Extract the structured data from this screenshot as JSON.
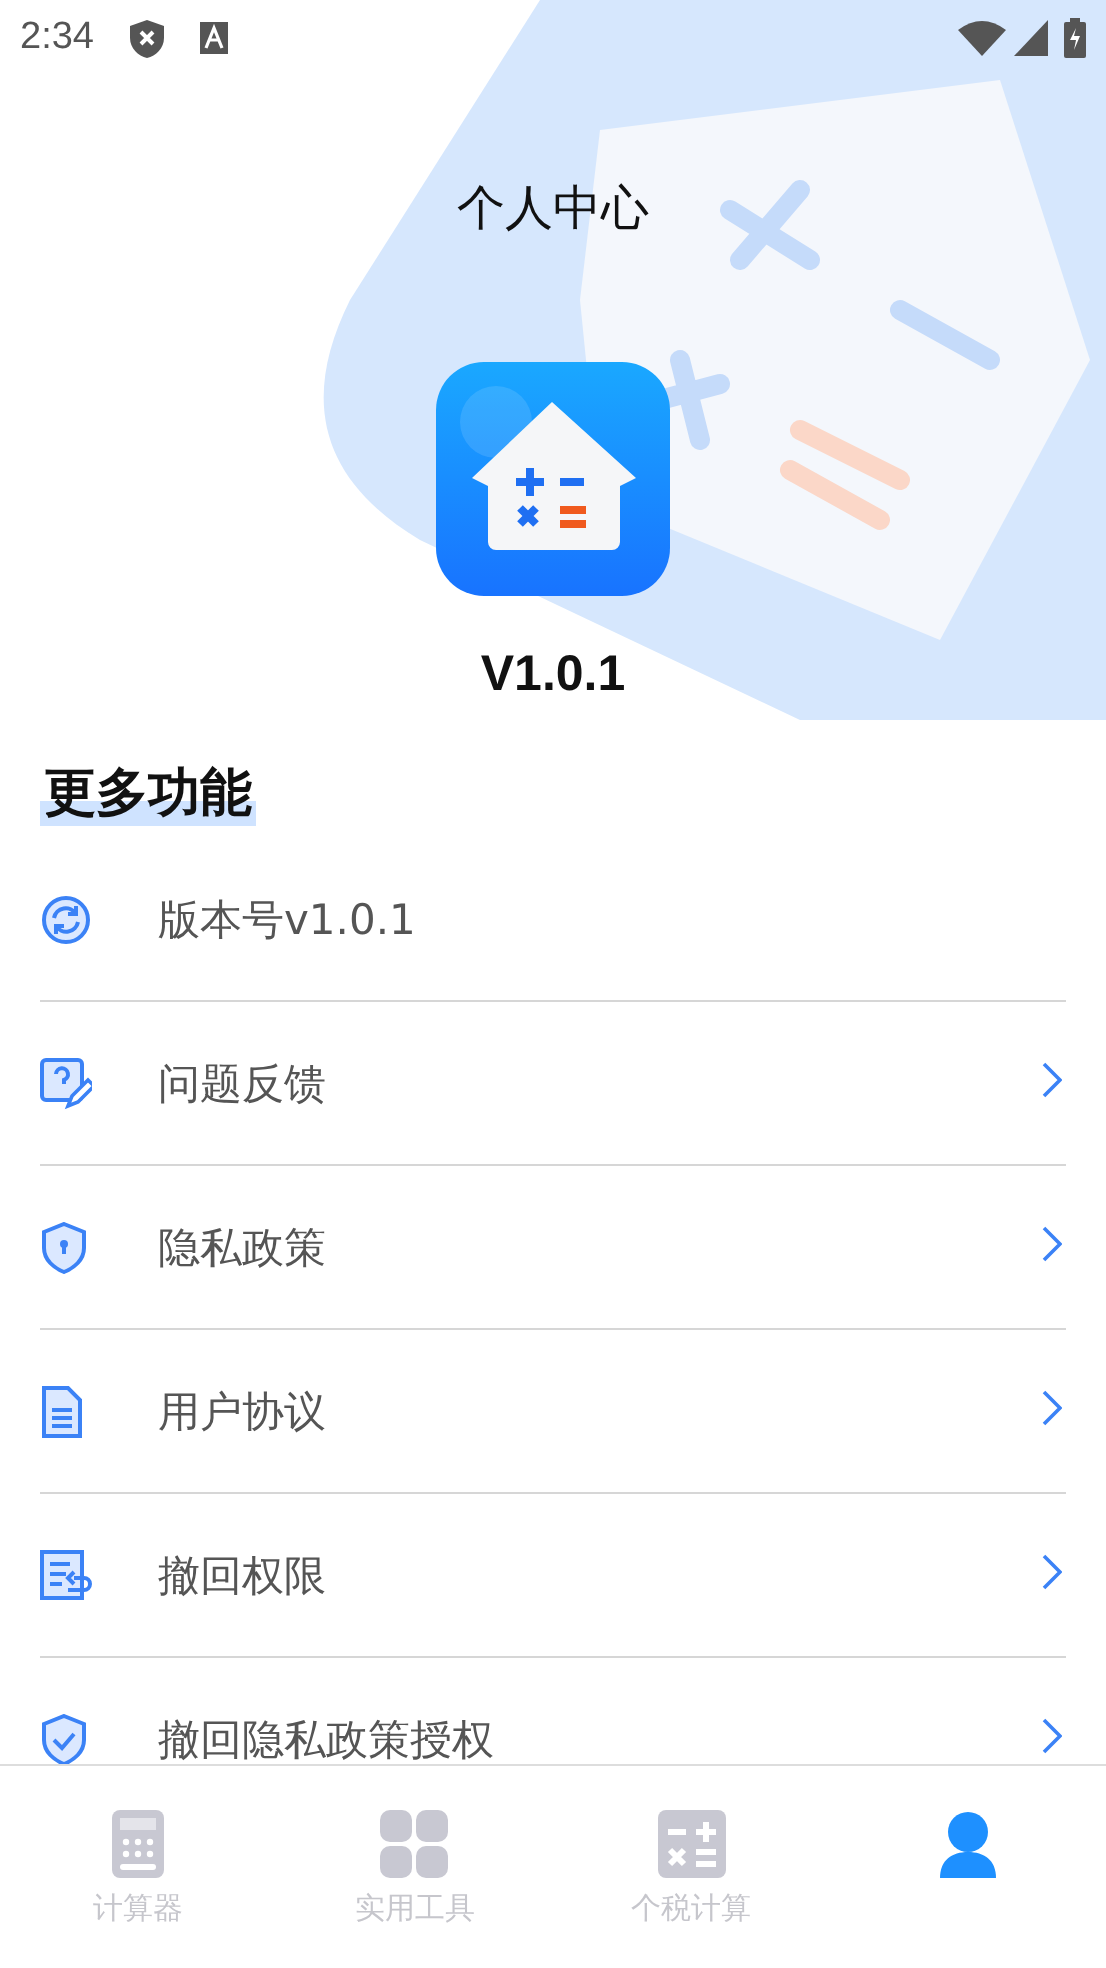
{
  "status_bar": {
    "time": "2:34"
  },
  "header": {
    "title": "个人中心",
    "version": "V1.0.1"
  },
  "section": {
    "title": "更多功能"
  },
  "menu": [
    {
      "label": "版本号v1.0.1",
      "kind": "info"
    },
    {
      "label": "问题反馈",
      "kind": "link"
    },
    {
      "label": "隐私政策",
      "kind": "link"
    },
    {
      "label": "用户协议",
      "kind": "link"
    },
    {
      "label": "撤回权限",
      "kind": "link"
    },
    {
      "label": "撤回隐私政策授权",
      "kind": "link"
    }
  ],
  "tabs": [
    {
      "label": "计算器",
      "selected": false
    },
    {
      "label": "实用工具",
      "selected": false
    },
    {
      "label": "个税计算",
      "selected": false
    },
    {
      "selected": true
    }
  ]
}
